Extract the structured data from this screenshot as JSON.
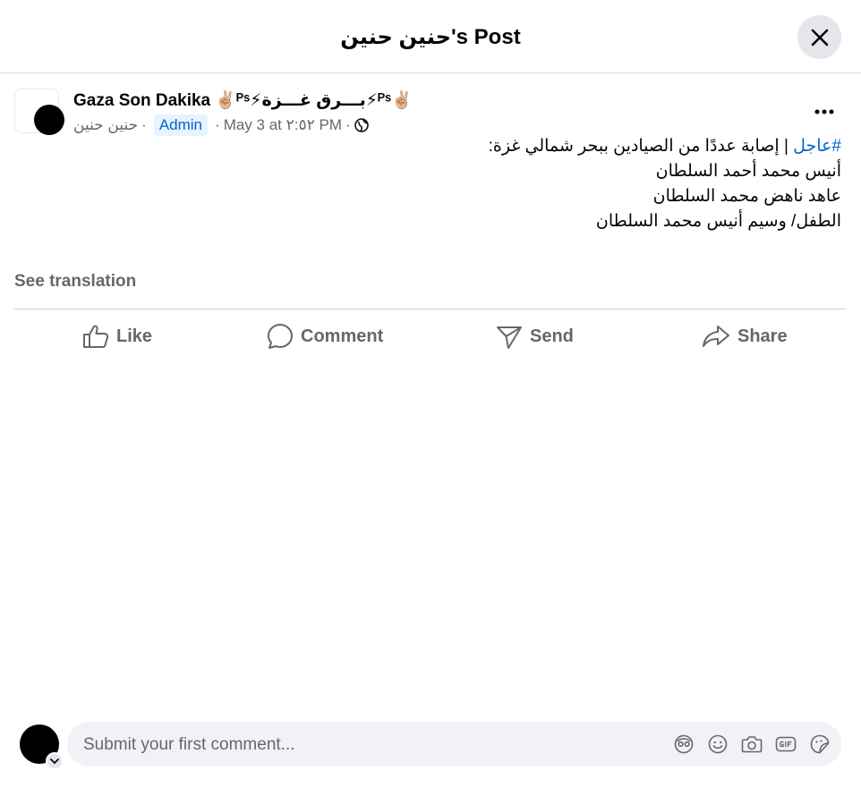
{
  "header": {
    "title": "حنين حنين's Post"
  },
  "post": {
    "group_name": "Gaza Son Dakika ✌🏼ᴾˢ⚡بـــرق غـــزة⚡ᴾˢ✌🏼",
    "author": "حنين حنين",
    "separator": "·",
    "role_badge": "Admin",
    "timestamp": "May 3 at ٢:٥٢ PM",
    "privacy_icon": "globe-icon",
    "hashtag": "#عاجل",
    "lines": [
      " | إصابة عددًا من الصيادين ببحر شمالي غزة:",
      "أنيس محمد أحمد السلطان",
      "عاهد ناهض محمد السلطان",
      "الطفل/ وسيم أنيس محمد السلطان"
    ],
    "see_translation": "See translation"
  },
  "actions": {
    "like": "Like",
    "comment": "Comment",
    "send": "Send",
    "share": "Share"
  },
  "composer": {
    "placeholder": "Submit your first comment...",
    "icons": [
      "avatar-sticker-icon",
      "emoji-icon",
      "camera-icon",
      "gif-icon",
      "sticker-icon"
    ]
  },
  "colors": {
    "link": "#0064d1",
    "muted": "#65676b",
    "surface": "#f0f2f5"
  }
}
